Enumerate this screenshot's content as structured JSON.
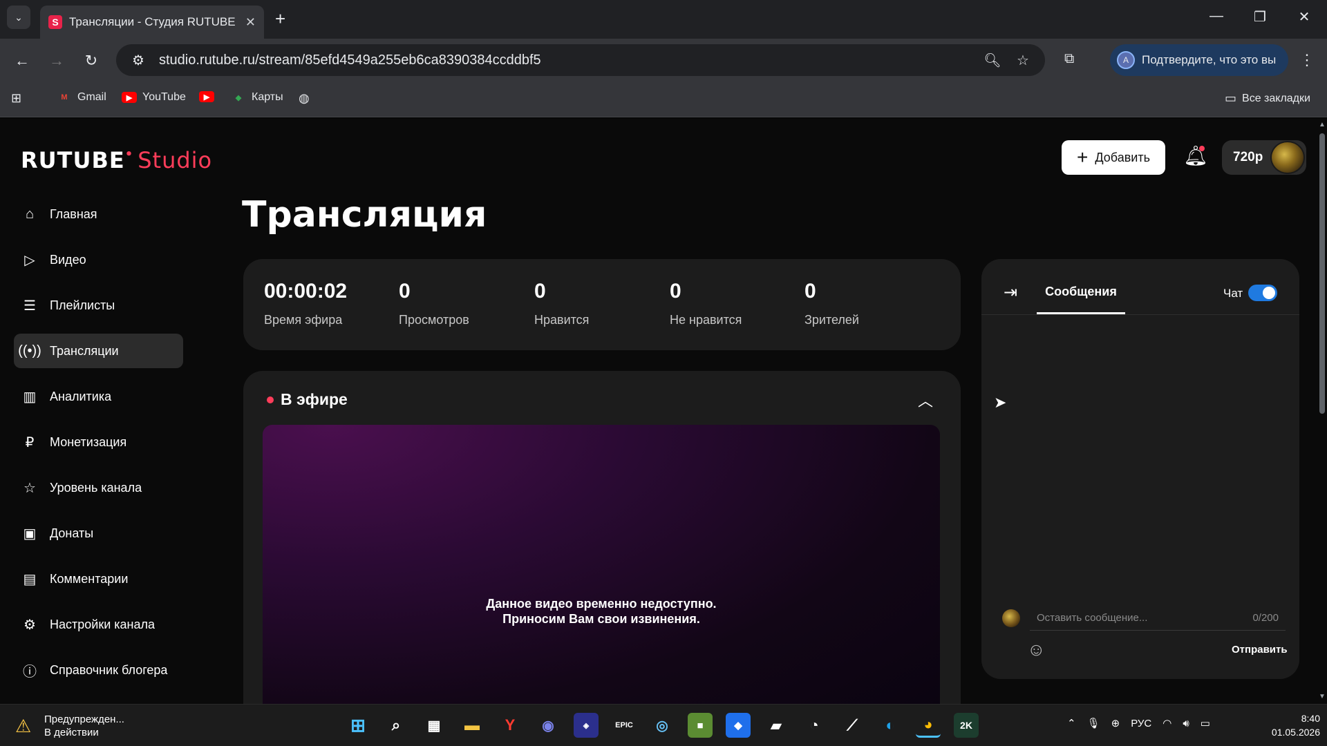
{
  "browser": {
    "tab_title": "Трансляции - Студия RUTUBE",
    "url": "studio.rutube.ru/stream/85efd4549a255eb6ca8390384ccddbf5",
    "verify_label": "Подтвердите, что это вы",
    "bookmarks": [
      "Gmail",
      "YouTube",
      "Карты"
    ],
    "all_bookmarks": "Все закладки"
  },
  "app": {
    "logo_main": "RUTUBE",
    "logo_studio": "Studio",
    "add_label": "Добавить",
    "quality": "720p",
    "page_title": "Трансляция"
  },
  "sidebar": {
    "items": [
      {
        "label": "Главная",
        "icon": "home-icon"
      },
      {
        "label": "Видео",
        "icon": "video-icon"
      },
      {
        "label": "Плейлисты",
        "icon": "playlist-icon"
      },
      {
        "label": "Трансляции",
        "icon": "broadcast-icon",
        "active": true
      },
      {
        "label": "Аналитика",
        "icon": "analytics-icon"
      },
      {
        "label": "Монетизация",
        "icon": "ruble-icon"
      },
      {
        "label": "Уровень канала",
        "icon": "star-icon"
      },
      {
        "label": "Донаты",
        "icon": "wallet-icon"
      },
      {
        "label": "Комментарии",
        "icon": "comment-icon"
      },
      {
        "label": "Настройки канала",
        "icon": "gear-icon"
      },
      {
        "label": "Справочник блогера",
        "icon": "info-icon"
      }
    ]
  },
  "stats": [
    {
      "value": "00:00:02",
      "label": "Время эфира"
    },
    {
      "value": "0",
      "label": "Просмотров"
    },
    {
      "value": "0",
      "label": "Нравится"
    },
    {
      "value": "0",
      "label": "Не нравится"
    },
    {
      "value": "0",
      "label": "Зрителей"
    }
  ],
  "live": {
    "title": "В эфире",
    "message_line1": "Данное видео временно недоступно.",
    "message_line2": "Приносим Вам свои извинения."
  },
  "chat": {
    "tab": "Сообщения",
    "toggle_label": "Чат",
    "toggle_on": true,
    "placeholder": "Оставить сообщение...",
    "counter": "0/200",
    "send": "Отправить"
  },
  "taskbar": {
    "warning_title": "Предупрежден...",
    "warning_sub": "В действии",
    "language": "РУС",
    "time": "8:40",
    "date": "01.05.2026"
  },
  "colors": {
    "accent": "#ff3d5a",
    "toggle": "#1f7ae0",
    "panel": "#1c1c1c"
  }
}
